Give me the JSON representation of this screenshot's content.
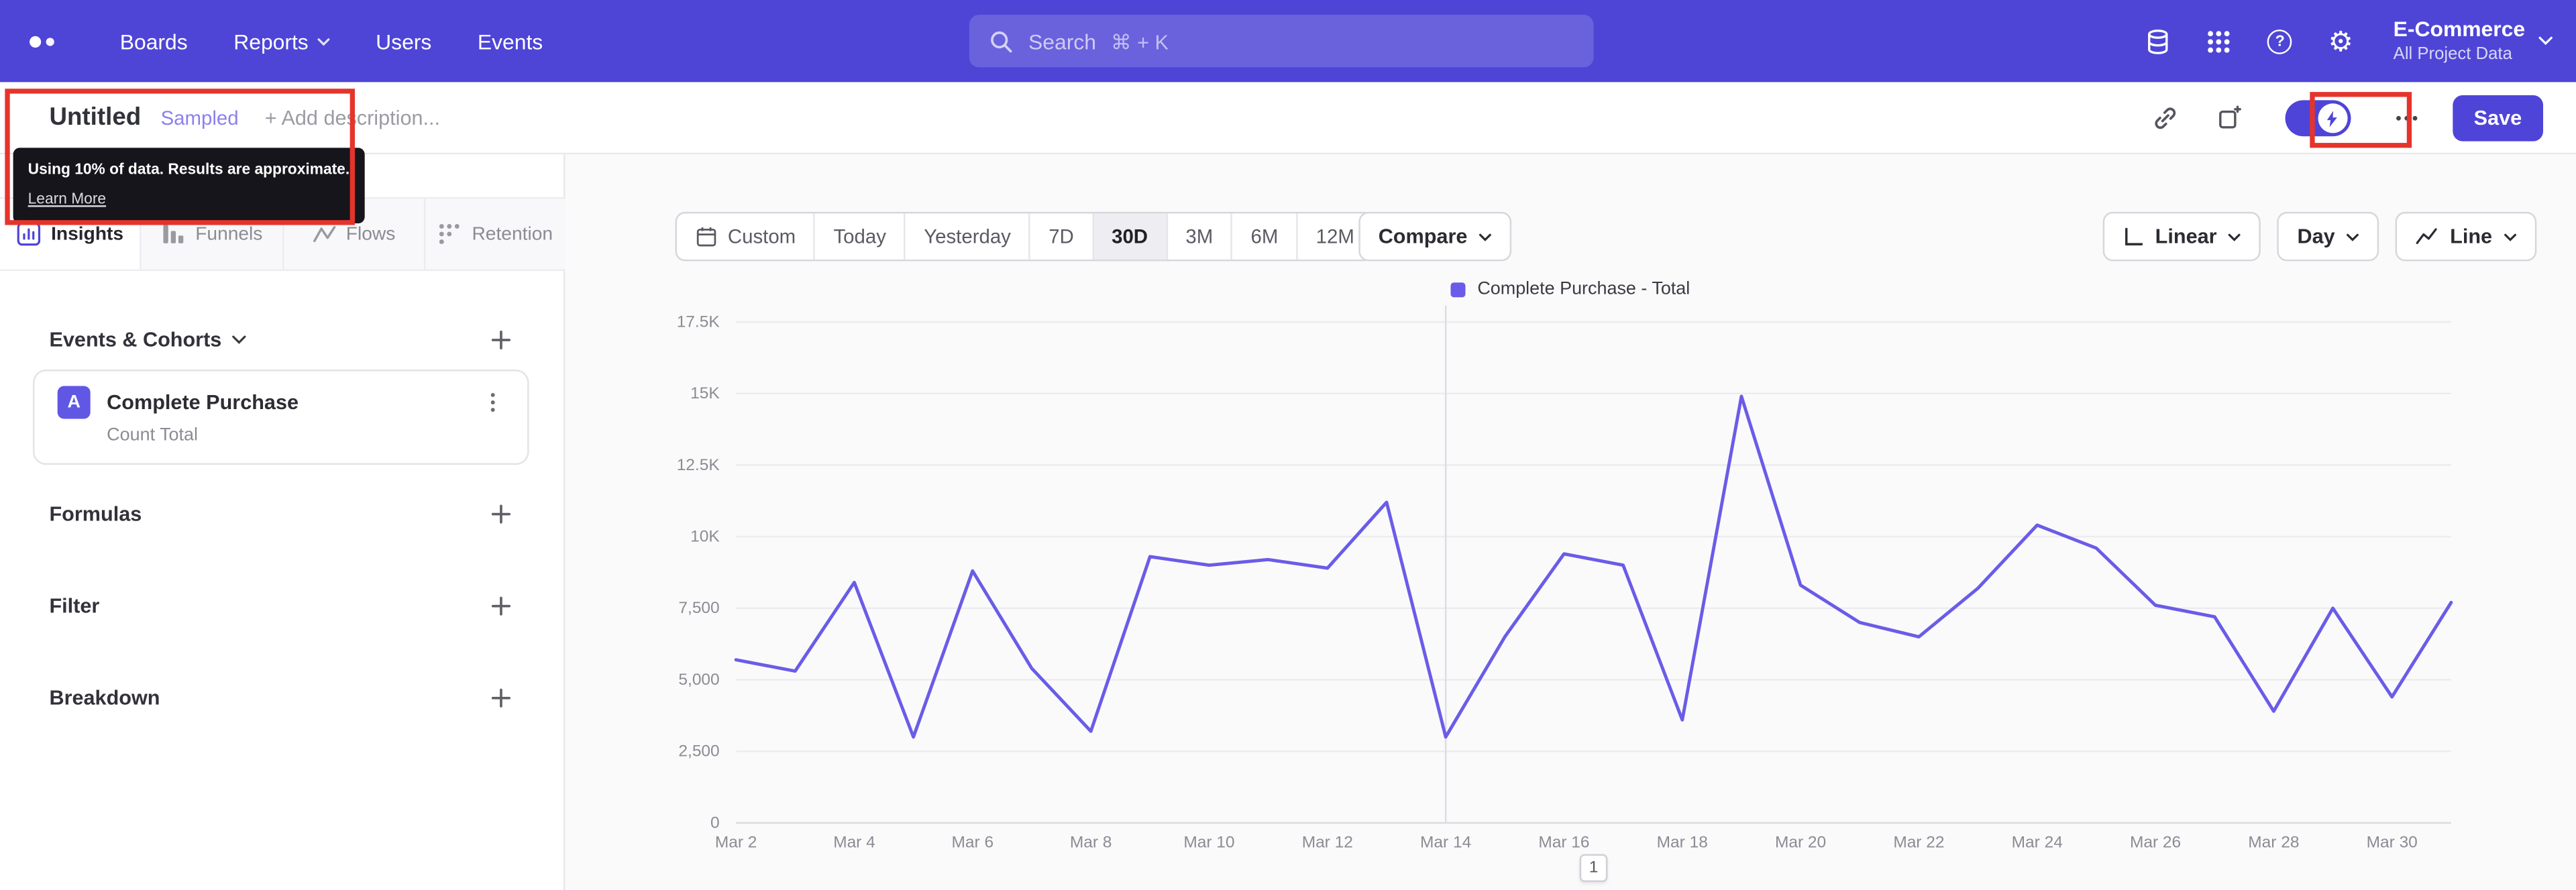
{
  "topnav": {
    "items": [
      {
        "label": "Boards"
      },
      {
        "label": "Reports"
      },
      {
        "label": "Users"
      },
      {
        "label": "Events"
      }
    ],
    "search": {
      "placeholder": "Search",
      "shortcut": "⌘ + K"
    },
    "project": {
      "name": "E-Commerce",
      "subtitle": "All Project Data"
    },
    "icons": {
      "gear": "⚙",
      "help": "?"
    }
  },
  "header": {
    "title": "Untitled",
    "badge": "Sampled",
    "description_placeholder": "+ Add description...",
    "save": "Save",
    "tooltip_text": "Using 10% of data. Results are approximate.",
    "tooltip_link": "Learn More"
  },
  "sidebar": {
    "tabs": [
      {
        "label": "Insights"
      },
      {
        "label": "Funnels"
      },
      {
        "label": "Flows"
      },
      {
        "label": "Retention"
      }
    ],
    "selected_tab": "Insights",
    "events_section_label": "Events & Cohorts",
    "event": {
      "badge": "A",
      "name": "Complete Purchase",
      "metric": "Count Total"
    },
    "sections": [
      {
        "label": "Formulas"
      },
      {
        "label": "Filter"
      },
      {
        "label": "Breakdown"
      }
    ]
  },
  "toolbar": {
    "ranges": [
      "Custom",
      "Today",
      "Yesterday",
      "7D",
      "30D",
      "3M",
      "6M",
      "12M"
    ],
    "selected_range": "30D",
    "compare": "Compare",
    "linear": "Linear",
    "granularity": "Day",
    "chart_type": "Line"
  },
  "chart_data": {
    "type": "line",
    "x": [
      "Mar 2",
      "Mar 3",
      "Mar 4",
      "Mar 5",
      "Mar 6",
      "Mar 7",
      "Mar 8",
      "Mar 9",
      "Mar 10",
      "Mar 11",
      "Mar 12",
      "Mar 13",
      "Mar 14",
      "Mar 15",
      "Mar 16",
      "Mar 17",
      "Mar 18",
      "Mar 19",
      "Mar 20",
      "Mar 21",
      "Mar 22",
      "Mar 23",
      "Mar 24",
      "Mar 25",
      "Mar 26",
      "Mar 27",
      "Mar 28",
      "Mar 29",
      "Mar 30",
      "Mar 31"
    ],
    "x_tick_labels": [
      "Mar 2",
      "Mar 4",
      "Mar 6",
      "Mar 8",
      "Mar 10",
      "Mar 12",
      "Mar 14",
      "Mar 16",
      "Mar 18",
      "Mar 20",
      "Mar 22",
      "Mar 24",
      "Mar 26",
      "Mar 28",
      "Mar 30"
    ],
    "series": [
      {
        "name": "Complete Purchase - Total",
        "color": "#6a5ce8",
        "values": [
          5700,
          5300,
          8400,
          3000,
          8800,
          5400,
          3200,
          9300,
          9000,
          9200,
          8900,
          11200,
          3000,
          6500,
          9400,
          9000,
          3600,
          14900,
          8300,
          7000,
          6500,
          8200,
          10400,
          9600,
          7600,
          7200,
          3900,
          7500,
          4400,
          7700
        ]
      }
    ],
    "ylim": [
      0,
      17500
    ],
    "yticks": [
      {
        "value": 0,
        "label": "0"
      },
      {
        "value": 2500,
        "label": "2,500"
      },
      {
        "value": 5000,
        "label": "5,000"
      },
      {
        "value": 7500,
        "label": "7,500"
      },
      {
        "value": 10000,
        "label": "10K"
      },
      {
        "value": 12500,
        "label": "12.5K"
      },
      {
        "value": 15000,
        "label": "15K"
      },
      {
        "value": 17500,
        "label": "17.5K"
      }
    ],
    "divider_x": "Mar 14",
    "grid": true,
    "legend_position": "top-center"
  },
  "pagination": "1",
  "colors": {
    "nav_bg": "#4e45d6",
    "accent": "#4f44d8",
    "line": "#6a5ce8",
    "annotation": "#e5342c"
  }
}
